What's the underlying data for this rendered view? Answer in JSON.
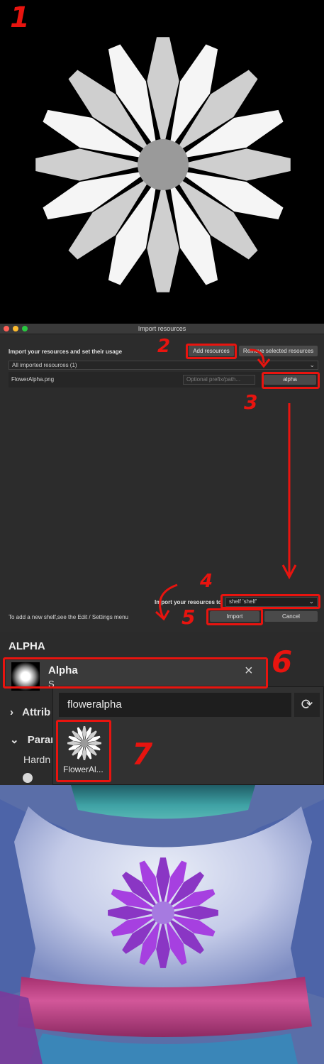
{
  "annotations": {
    "step1": "1",
    "step2": "2",
    "step3": "3",
    "step4": "4",
    "step5": "5",
    "step6": "6",
    "step7": "7",
    "color": "#e8140f"
  },
  "flower": {
    "petal_light": "#f5f5f5",
    "petal_dark": "#cfcfcf",
    "center": "#9a9a9a",
    "background": "#000000"
  },
  "dialog": {
    "window_title": "Import resources",
    "heading": "Import your resources and set their usage",
    "add_resources_label": "Add resources",
    "remove_selected_label": "Remove selected resources",
    "filter_value": "All imported resources (1)",
    "resource_row": {
      "filename": "FlowerAlpha.png",
      "prefix_placeholder": "Optional prefix/path...",
      "usage": "alpha"
    },
    "import_to_label": "Import your resources to",
    "shelf_value": "shelf 'shelf'",
    "hint": "To add a new shelf,see the Edit / Settings menu",
    "import_button": "Import",
    "cancel_button": "Cancel"
  },
  "alpha_panel": {
    "section_title": "ALPHA",
    "slot_name": "Alpha",
    "slot_sub": "S",
    "attributes_label": "Attrib",
    "parameters_label": "Paran",
    "hardness_label": "Hardn",
    "search_value": "floweralpha",
    "result_label": "FlowerAl..."
  },
  "model": {
    "shirt_color": "#b8c0e2",
    "collar_color": "#3a9aa0",
    "flower_color": "#a640e0",
    "flower_center": "#a67ae0",
    "band_color": "#c23c8c"
  }
}
